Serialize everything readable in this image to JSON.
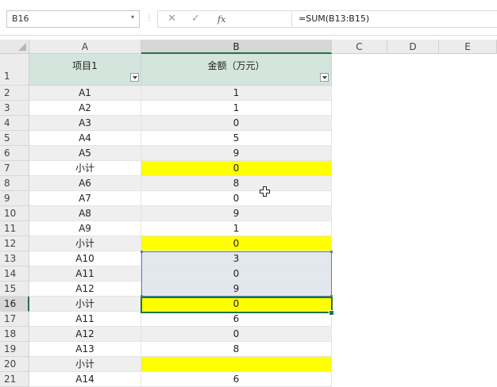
{
  "formula_bar": {
    "name_box": "B16",
    "name_arrow": "▾",
    "separator": "⋮",
    "cancel_glyph": "✕",
    "enter_glyph": "✓",
    "fx_label": "fx",
    "formula": "=SUM(B13:B15)"
  },
  "columns": [
    "A",
    "B",
    "C",
    "D",
    "E"
  ],
  "header_row": {
    "row": "1",
    "a": "项目1",
    "b": "金额（万元）"
  },
  "rows": [
    {
      "r": "2",
      "a": "A1",
      "b": "1",
      "hl": false
    },
    {
      "r": "3",
      "a": "A2",
      "b": "1",
      "hl": false
    },
    {
      "r": "4",
      "a": "A3",
      "b": "0",
      "hl": false
    },
    {
      "r": "5",
      "a": "A4",
      "b": "5",
      "hl": false
    },
    {
      "r": "6",
      "a": "A5",
      "b": "9",
      "hl": false
    },
    {
      "r": "7",
      "a": "小计",
      "b": "0",
      "hl": true
    },
    {
      "r": "8",
      "a": "A6",
      "b": "8",
      "hl": false
    },
    {
      "r": "9",
      "a": "A7",
      "b": "0",
      "hl": false
    },
    {
      "r": "10",
      "a": "A8",
      "b": "9",
      "hl": false
    },
    {
      "r": "11",
      "a": "A9",
      "b": "1",
      "hl": false
    },
    {
      "r": "12",
      "a": "小计",
      "b": "0",
      "hl": true
    },
    {
      "r": "13",
      "a": "A10",
      "b": "3",
      "hl": false
    },
    {
      "r": "14",
      "a": "A11",
      "b": "0",
      "hl": false
    },
    {
      "r": "15",
      "a": "A12",
      "b": "9",
      "hl": false
    },
    {
      "r": "16",
      "a": "小计",
      "b": "0",
      "hl": true
    },
    {
      "r": "17",
      "a": "A11",
      "b": "6",
      "hl": false
    },
    {
      "r": "18",
      "a": "A12",
      "b": "0",
      "hl": false
    },
    {
      "r": "19",
      "a": "A13",
      "b": "8",
      "hl": false
    },
    {
      "r": "20",
      "a": "小计",
      "b": "",
      "hl": true
    },
    {
      "r": "21",
      "a": "A14",
      "b": "6",
      "hl": false
    }
  ],
  "active_cell": "B16",
  "selected_range": "B13:B15",
  "colors": {
    "header_fill": "#d4e5dd",
    "highlight": "#ffff00",
    "selection_accent": "#217346"
  }
}
